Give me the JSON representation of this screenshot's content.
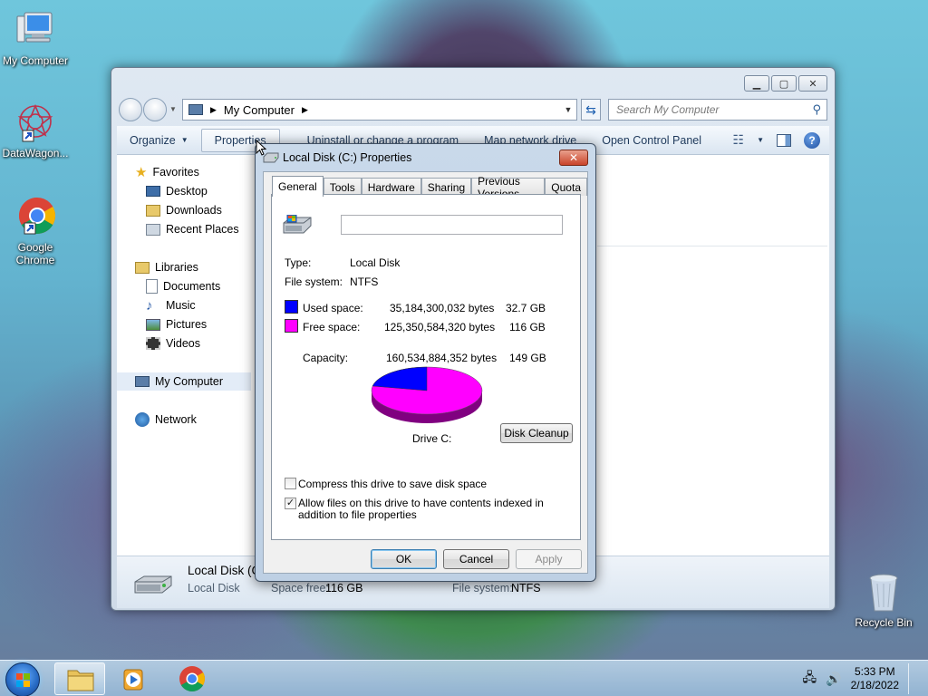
{
  "desktop": {
    "icons": [
      {
        "label": "My Computer",
        "icon": "computer-icon"
      },
      {
        "label": "DataWagon...",
        "icon": "datawagon-icon"
      },
      {
        "label": "Google Chrome",
        "icon": "chrome-icon"
      },
      {
        "label": "Recycle Bin",
        "icon": "recycle-bin-icon"
      }
    ]
  },
  "explorer": {
    "address": {
      "location": "My Computer"
    },
    "search": {
      "placeholder": "Search My Computer"
    },
    "commands": {
      "organize": "Organize",
      "properties": "Properties",
      "uninstall": "Uninstall or change a program",
      "map_drive": "Map network drive",
      "control_panel": "Open Control Panel"
    },
    "nav": {
      "favorites": "Favorites",
      "desktop": "Desktop",
      "downloads": "Downloads",
      "recent": "Recent Places",
      "libraries": "Libraries",
      "documents": "Documents",
      "music": "Music",
      "pictures": "Pictures",
      "videos": "Videos",
      "computer": "My Computer",
      "network": "Network"
    },
    "status": {
      "name": "Local Disk (C:)",
      "type": "Local Disk",
      "space_free_label": "Space free:",
      "space_free": "116 GB",
      "fs_label": "File system:",
      "fs": "NTFS"
    }
  },
  "dialog": {
    "title": "Local Disk (C:) Properties",
    "tabs": [
      "General",
      "Tools",
      "Hardware",
      "Sharing",
      "Previous Versions",
      "Quota"
    ],
    "active_tab": "General",
    "volume_label": "",
    "type_label": "Type:",
    "type_value": "Local Disk",
    "fs_label": "File system:",
    "fs_value": "NTFS",
    "used_label": "Used space:",
    "used_bytes": "35,184,300,032 bytes",
    "used_size": "32.7 GB",
    "free_label": "Free space:",
    "free_bytes": "125,350,584,320 bytes",
    "free_size": "116 GB",
    "capacity_label": "Capacity:",
    "capacity_bytes": "160,534,884,352 bytes",
    "capacity_size": "149 GB",
    "used_color": "#0000ff",
    "free_color": "#ff00ff",
    "used_fraction": 0.219,
    "drive_label": "Drive C:",
    "disk_cleanup": "Disk Cleanup",
    "compress_label": "Compress this drive to save disk space",
    "compress_checked": false,
    "index_label": "Allow files on this drive to have contents indexed in addition to file properties",
    "index_checked": true,
    "ok": "OK",
    "cancel": "Cancel",
    "apply": "Apply"
  },
  "taskbar": {
    "time": "5:33 PM",
    "date": "2/18/2022"
  }
}
